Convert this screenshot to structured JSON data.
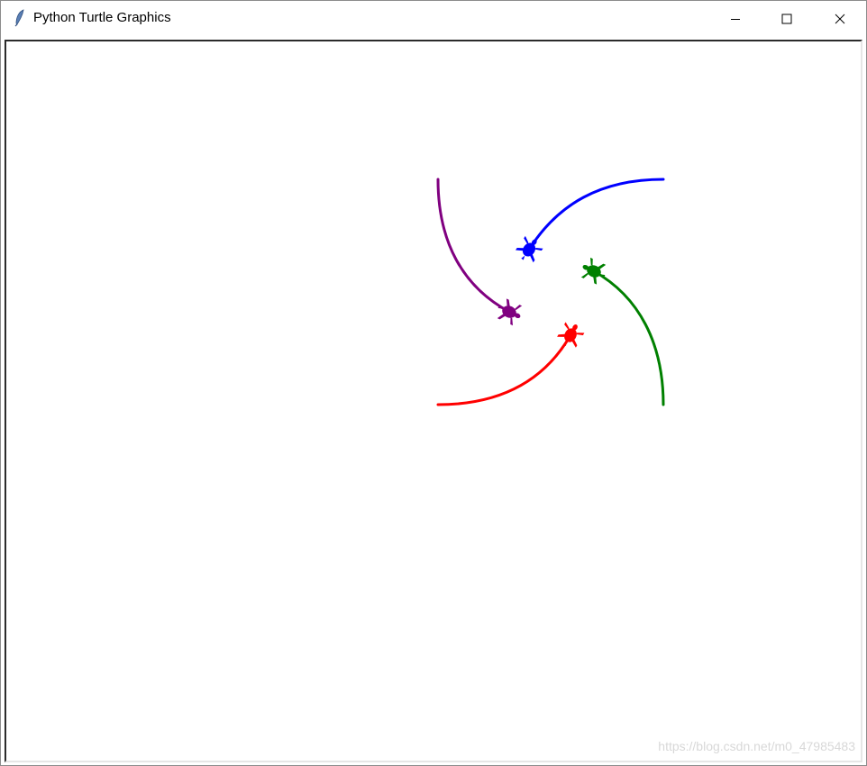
{
  "window": {
    "title": "Python Turtle Graphics",
    "app_icon": "feather-icon"
  },
  "caption_buttons": {
    "minimize_icon": "minimize-icon",
    "maximize_icon": "maximize-icon",
    "close_icon": "close-icon"
  },
  "turtles": [
    {
      "name": "blue-turtle",
      "color": "#0000ff"
    },
    {
      "name": "green-turtle",
      "color": "#008000"
    },
    {
      "name": "red-turtle",
      "color": "#ff0000"
    },
    {
      "name": "purple-turtle",
      "color": "#800080"
    }
  ],
  "watermark": {
    "text": "https://blog.csdn.net/m0_47985483"
  }
}
